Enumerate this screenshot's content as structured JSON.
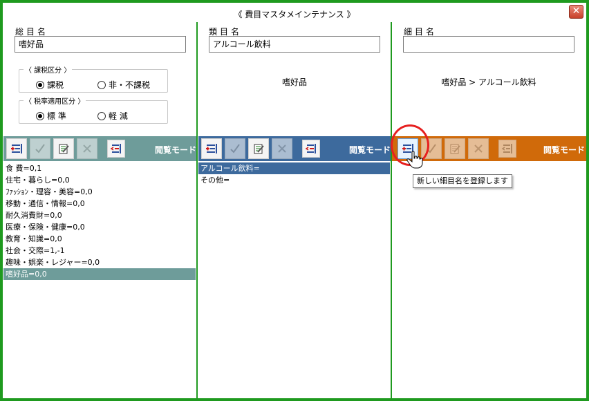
{
  "window": {
    "title": "《 費目マスタメインテナンス 》",
    "close_glyph": "✕"
  },
  "colors": {
    "frame": "#1f9a1f",
    "teal": "#6e9c9a",
    "blue": "#3d6a9d",
    "orange": "#d06a0a",
    "highlight": "#e62020"
  },
  "col1": {
    "label": "総目名",
    "field_value": "嗜好品",
    "tax_group": {
      "legend": "〈 課税区分 〉",
      "options": [
        "課税",
        "非・不課税"
      ],
      "selected": "課税"
    },
    "rate_group": {
      "legend": "〈 税率適用区分 〉",
      "options": [
        "標 準",
        "軽 減"
      ],
      "selected": "標 準"
    },
    "mode": "閲覧モード",
    "items": [
      "食 費=0,1",
      "住宅・暮らし=0,0",
      "ﾌｧｯｼｮﾝ・理容・美容=0,0",
      "移動・通信・情報=0,0",
      "耐久消費財=0,0",
      "医療・保険・健康=0,0",
      "教育・知識=0,0",
      "社会・交際=1,-1",
      "趣味・娯楽・レジャー=0,0",
      "嗜好品=0,0"
    ],
    "selected_index": 9
  },
  "col2": {
    "label": "類目名",
    "field_value": "アルコール飲料",
    "breadcrumb": "嗜好品",
    "mode": "閲覧モード",
    "items": [
      "アルコール飲料=",
      "その他="
    ],
    "selected_index": 0
  },
  "col3": {
    "label": "細目名",
    "field_value": "",
    "breadcrumb": "嗜好品 > アルコール飲料",
    "mode": "閲覧モード",
    "items": []
  },
  "tooltip": "新しい細目名を登録します",
  "icons": [
    "add-icon",
    "check-icon",
    "edit-icon",
    "delete-icon",
    "reorder-icon"
  ]
}
